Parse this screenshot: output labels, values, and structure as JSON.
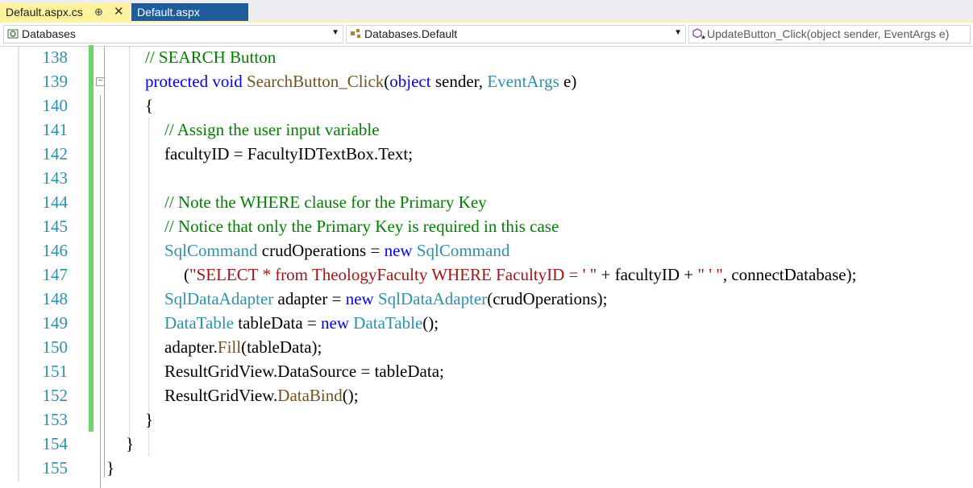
{
  "tabs": [
    {
      "label": "Default.aspx.cs",
      "active": true,
      "pin_glyph": "⊕",
      "close_glyph": "✕"
    },
    {
      "label": "Default.aspx",
      "active": false
    }
  ],
  "navbar": {
    "project": "Databases",
    "class": "Databases.Default",
    "member": "UpdateButton_Click(object sender, EventArgs e)"
  },
  "colors": {
    "keyword": "#0000ff",
    "type": "#2b91af",
    "comment": "#008000",
    "string": "#a31515",
    "method": "#74531f",
    "line_number": "#2b91af",
    "change_bar": "#6bd46b",
    "active_tab": "#fff29d",
    "inactive_tab": "#1e5c9c"
  },
  "editor": {
    "lines": [
      {
        "n": "138",
        "tokens": [
          [
            "cm",
            "// SEARCH Button"
          ]
        ]
      },
      {
        "n": "139",
        "tokens": [
          [
            "kw",
            "protected"
          ],
          [
            "pl",
            " "
          ],
          [
            "kw",
            "void"
          ],
          [
            "pl",
            " "
          ],
          [
            "mt",
            "SearchButton_Click"
          ],
          [
            "pl",
            "("
          ],
          [
            "kw",
            "object"
          ],
          [
            "pl",
            " sender, "
          ],
          [
            "ty",
            "EventArgs"
          ],
          [
            "pl",
            " e)"
          ]
        ]
      },
      {
        "n": "140",
        "tokens": [
          [
            "pl",
            "{"
          ]
        ]
      },
      {
        "n": "141",
        "tokens": [
          [
            "cm",
            "// Assign the user input variable"
          ]
        ]
      },
      {
        "n": "142",
        "tokens": [
          [
            "pl",
            "facultyID = FacultyIDTextBox.Text;"
          ]
        ]
      },
      {
        "n": "143",
        "tokens": []
      },
      {
        "n": "144",
        "tokens": [
          [
            "cm",
            "// Note the WHERE clause for the Primary Key"
          ]
        ]
      },
      {
        "n": "145",
        "tokens": [
          [
            "cm",
            "// Notice that only the Primary Key is required in this case"
          ]
        ]
      },
      {
        "n": "146",
        "tokens": [
          [
            "ty",
            "SqlCommand"
          ],
          [
            "pl",
            " crudOperations = "
          ],
          [
            "kw",
            "new"
          ],
          [
            "pl",
            " "
          ],
          [
            "ty",
            "SqlCommand"
          ]
        ]
      },
      {
        "n": "147",
        "tokens": [
          [
            "pl",
            "("
          ],
          [
            "st",
            "\"SELECT * from TheologyFaculty WHERE FacultyID = ' \""
          ],
          [
            "pl",
            " + facultyID + "
          ],
          [
            "st",
            "\" ' \""
          ],
          [
            "pl",
            ", connectDatabase);"
          ]
        ]
      },
      {
        "n": "148",
        "tokens": [
          [
            "ty",
            "SqlDataAdapter"
          ],
          [
            "pl",
            " adapter = "
          ],
          [
            "kw",
            "new"
          ],
          [
            "pl",
            " "
          ],
          [
            "ty",
            "SqlDataAdapter"
          ],
          [
            "pl",
            "(crudOperations);"
          ]
        ]
      },
      {
        "n": "149",
        "tokens": [
          [
            "ty",
            "DataTable"
          ],
          [
            "pl",
            " tableData = "
          ],
          [
            "kw",
            "new"
          ],
          [
            "pl",
            " "
          ],
          [
            "ty",
            "DataTable"
          ],
          [
            "pl",
            "();"
          ]
        ]
      },
      {
        "n": "150",
        "tokens": [
          [
            "pl",
            "adapter."
          ],
          [
            "mt",
            "Fill"
          ],
          [
            "pl",
            "(tableData);"
          ]
        ]
      },
      {
        "n": "151",
        "tokens": [
          [
            "pl",
            "ResultGridView.DataSource = tableData;"
          ]
        ]
      },
      {
        "n": "152",
        "tokens": [
          [
            "pl",
            "ResultGridView."
          ],
          [
            "mt",
            "DataBind"
          ],
          [
            "pl",
            "();"
          ]
        ]
      },
      {
        "n": "153",
        "tokens": [
          [
            "pl",
            "}"
          ]
        ]
      },
      {
        "n": "154",
        "tokens": [
          [
            "pl",
            "}"
          ]
        ]
      },
      {
        "n": "155",
        "tokens": [
          [
            "pl",
            "}"
          ]
        ]
      }
    ]
  }
}
